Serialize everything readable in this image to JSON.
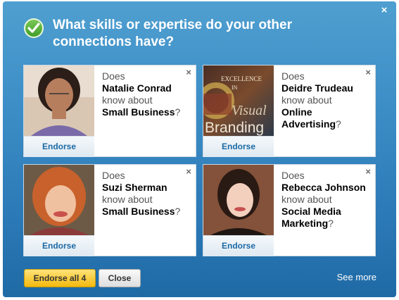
{
  "dialog": {
    "close_symbol": "×",
    "title": "What skills or expertise do your other connections have?",
    "icon": "checkmark-circle-icon"
  },
  "cards": [
    {
      "does": "Does",
      "name": "Natalie Conrad",
      "know": "know about",
      "skill": "Small Business",
      "q": "?",
      "endorse": "Endorse",
      "dismiss": "×"
    },
    {
      "does": "Does",
      "name": "Deidre Trudeau",
      "know": "know about",
      "skill": "Online Advertising",
      "q": "?",
      "endorse": "Endorse",
      "dismiss": "×",
      "photo_text": {
        "line1": "EXCELLENCE",
        "line2": "IN",
        "line3": "Visual",
        "line4": "Branding"
      }
    },
    {
      "does": "Does",
      "name": "Suzi Sherman",
      "know": "know about",
      "skill": "Small Business",
      "q": "?",
      "endorse": "Endorse",
      "dismiss": "×"
    },
    {
      "does": "Does",
      "name": "Rebecca Johnson",
      "know": "know about",
      "skill": "Social Media Marketing",
      "q": "?",
      "endorse": "Endorse",
      "dismiss": "×"
    }
  ],
  "footer": {
    "endorse_all": "Endorse all 4",
    "close": "Close",
    "see_more": "See more"
  }
}
